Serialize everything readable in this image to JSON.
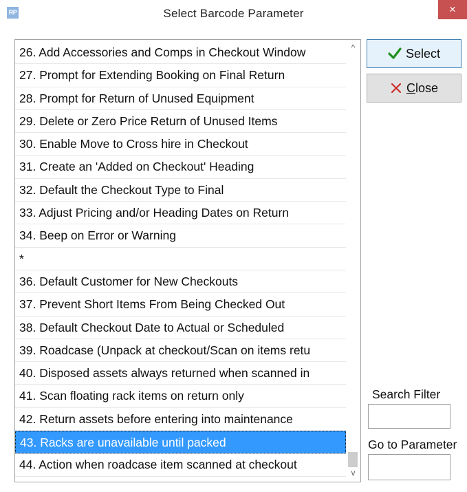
{
  "window": {
    "app_icon": "RP",
    "title": "Select Barcode Parameter",
    "close_glyph": "×"
  },
  "list": {
    "items": [
      "26. Add Accessories and Comps in Checkout Window",
      "27. Prompt for Extending Booking on Final Return",
      "28. Prompt for Return of Unused Equipment",
      "29. Delete or Zero Price Return of Unused Items",
      "30. Enable Move to Cross hire in Checkout",
      "31. Create an 'Added on Checkout' Heading",
      "32. Default the Checkout Type to Final",
      "33. Adjust Pricing and/or Heading Dates on Return",
      "34. Beep on Error or Warning",
      "*",
      "36. Default Customer for New Checkouts",
      "37. Prevent Short Items From Being Checked Out",
      "38. Default Checkout Date to Actual or Scheduled",
      "39. Roadcase (Unpack at checkout/Scan on items retu",
      "40. Disposed assets always returned when scanned in",
      "41. Scan floating rack items on return only",
      "42. Return assets before entering into maintenance",
      "43. Racks are unavailable until packed",
      "44. Action when roadcase item scanned at checkout"
    ],
    "selected_item": "43. Racks are unavailable until packed",
    "scroll_up_glyph": "^",
    "scroll_down_glyph": "v"
  },
  "buttons": {
    "select": {
      "label": "Select",
      "icon": "checkmark-icon"
    },
    "close": {
      "mnemonic": "C",
      "label_rest": "lose",
      "icon": "x-icon"
    }
  },
  "search_filter": {
    "label": "Search Filter",
    "value": ""
  },
  "go_to_parameter": {
    "label": "Go to Parameter",
    "value": ""
  },
  "colors": {
    "selection": "#3399ff",
    "select_button_border": "#3c7fb1",
    "checkmark": "#1f8f1f",
    "close_x": "#cc2222",
    "window_close": "#c75050"
  }
}
